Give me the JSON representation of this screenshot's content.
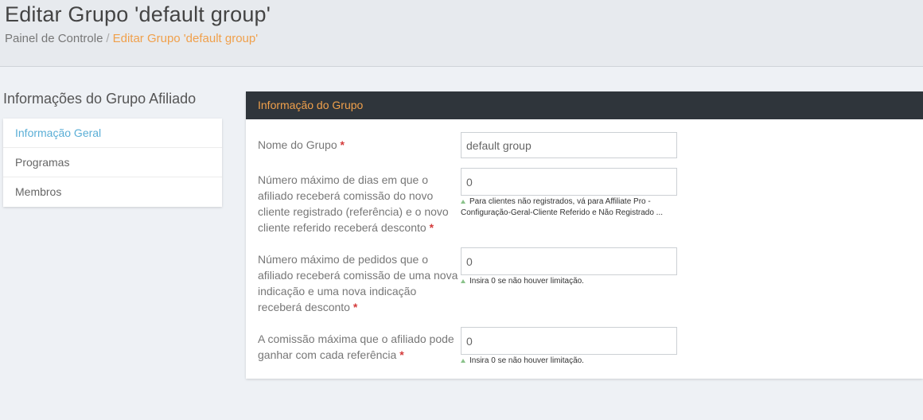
{
  "header": {
    "title": "Editar Grupo 'default group'",
    "breadcrumb_home": "Painel de Controle",
    "breadcrumb_sep": "/",
    "breadcrumb_current": "Editar Grupo 'default group'"
  },
  "sidebar": {
    "title": "Informações do Grupo Afiliado",
    "items": [
      {
        "label": "Informação Geral",
        "active": true
      },
      {
        "label": "Programas",
        "active": false
      },
      {
        "label": "Membros",
        "active": false
      }
    ]
  },
  "panel": {
    "title": "Informação do Grupo",
    "fields": [
      {
        "label": "Nome do Grupo",
        "required": "*",
        "value": "default group",
        "hint": ""
      },
      {
        "label": "Número máximo de dias em que o afiliado receberá comissão do novo cliente registrado (referência) e o novo cliente referido receberá desconto",
        "required": "*",
        "value": "0",
        "hint": "Para clientes não registrados, vá para Affiliate Pro - Configuração-Geral-Cliente Referido e Não Registrado ..."
      },
      {
        "label": "Número máximo de pedidos que o afiliado receberá comissão de uma nova indicação e uma nova indicação receberá desconto",
        "required": "*",
        "value": "0",
        "hint": "Insira 0 se não houver limitação."
      },
      {
        "label": "A comissão máxima que o afiliado pode ganhar com cada referência",
        "required": "*",
        "value": "0",
        "hint": "Insira 0 se não houver limitação."
      }
    ]
  },
  "colors": {
    "accent_orange": "#f0a04b",
    "active_blue": "#5aaed6",
    "panel_header_bg": "#2f353b",
    "required_red": "#d43b3b"
  }
}
